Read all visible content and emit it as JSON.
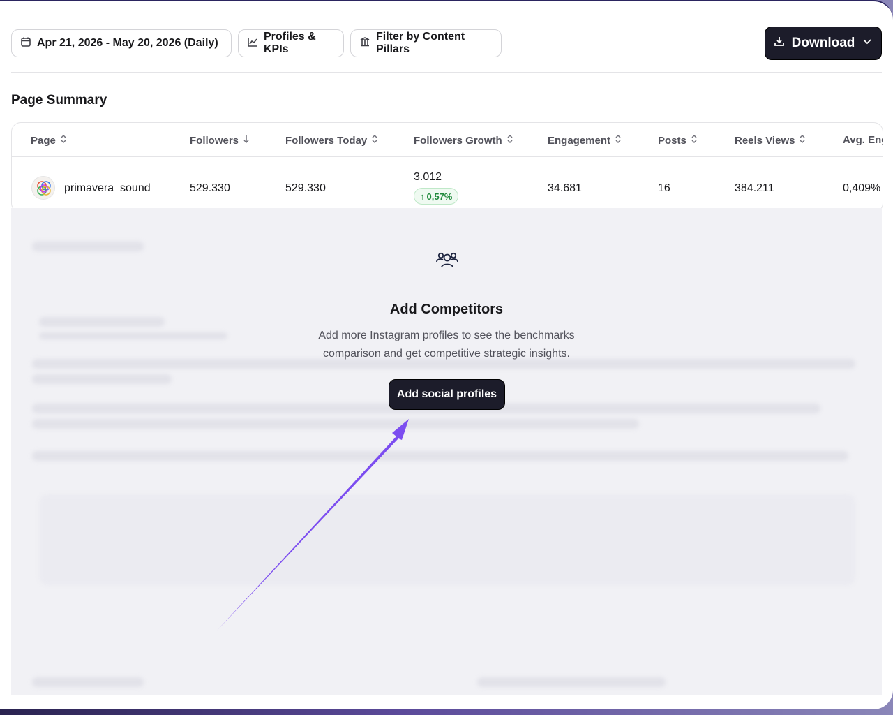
{
  "toolbar": {
    "date_range": "Apr 21, 2026 - May 20, 2026 (Daily)",
    "profiles_kpis": "Profiles & KPIs",
    "filter_pillars": "Filter by Content Pillars",
    "download": "Download"
  },
  "section_title": "Page Summary",
  "table": {
    "headers": [
      "Page",
      "Followers",
      "Followers Today",
      "Followers Growth",
      "Engagement",
      "Posts",
      "Reels Views",
      "Avg. Eng"
    ],
    "row": {
      "page": "primavera_sound",
      "followers": "529.330",
      "followers_today": "529.330",
      "followers_growth": "3.012",
      "growth_pct": "0,57%",
      "engagement": "34.681",
      "posts": "16",
      "reels_views": "384.211",
      "avg_eng": "0,409%"
    }
  },
  "competitors": {
    "title": "Add Competitors",
    "description": "Add more Instagram profiles to see the benchmarks comparison and get competitive strategic insights.",
    "button": "Add social profiles"
  },
  "colors": {
    "primary_button": "#1c1c2a",
    "arrow": "#7c4df0",
    "growth_green": "#1f8a3b"
  }
}
